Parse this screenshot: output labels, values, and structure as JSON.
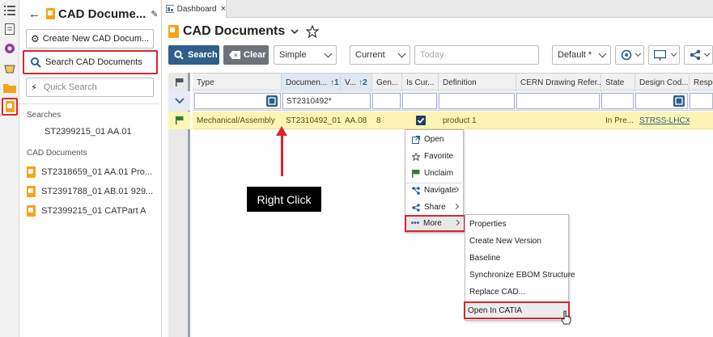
{
  "sidebar": {
    "title": "CAD Docume...",
    "create_button": "Create New CAD Docum...",
    "search_button": "Search CAD Documents",
    "quick_search": "Quick Search",
    "searches_heading": "Searches",
    "searches": [
      "ST2399215_01 AA.01"
    ],
    "cad_heading": "CAD Documents",
    "cad_items": [
      "ST2318659_01 AA.01 Pro...",
      "ST2391788_01 AB.01 929...",
      "ST2399215_01 CATPart A"
    ]
  },
  "tabs": [
    {
      "label": "Dashboard",
      "close": "×"
    }
  ],
  "main": {
    "title": "CAD Documents"
  },
  "toolbar": {
    "search": "Search",
    "clear": "Clear",
    "mode": "Simple",
    "revision": "Current",
    "date_placeholder": "Today",
    "view": "Default *"
  },
  "grid": {
    "columns": [
      {
        "label": "Type"
      },
      {
        "label": "Documen...",
        "sort": "↑1"
      },
      {
        "label": "V...",
        "sort": "↑2"
      },
      {
        "label": "Gen..."
      },
      {
        "label": "Is Cur..."
      },
      {
        "label": "Definition"
      },
      {
        "label": "CERN Drawing Refer..."
      },
      {
        "label": "State"
      },
      {
        "label": "Design Cod..."
      },
      {
        "label": "Respo"
      }
    ],
    "filter_document": "ST2310492*",
    "row": {
      "type": "Mechanical/Assembly",
      "document": "ST2310492_01",
      "version": "AA.08",
      "generation": "8",
      "definition": "product 1",
      "state": "In Pre...",
      "design_code": "STRSS-LHCX"
    }
  },
  "context_menu": {
    "items": [
      {
        "label": "Open",
        "icon": "open-external-icon"
      },
      {
        "label": "Favorite",
        "icon": "star-icon"
      },
      {
        "label": "Unclaim",
        "icon": "flag-icon"
      },
      {
        "label": "Navigate",
        "icon": "navigate-icon"
      },
      {
        "label": "Share",
        "icon": "share-icon"
      },
      {
        "label": "More",
        "icon": "more-dots-icon"
      }
    ],
    "submenu": [
      "Properties",
      "Create New Version",
      "Baseline",
      "Synchronize EBOM Structure",
      "Replace CAD...",
      "Open In CATIA"
    ]
  },
  "annotation": {
    "callout": "Right Click"
  },
  "colors": {
    "accent": "#2f5f8a",
    "highlight_red": "#d9262b",
    "row_yellow": "#fdf5b5"
  }
}
